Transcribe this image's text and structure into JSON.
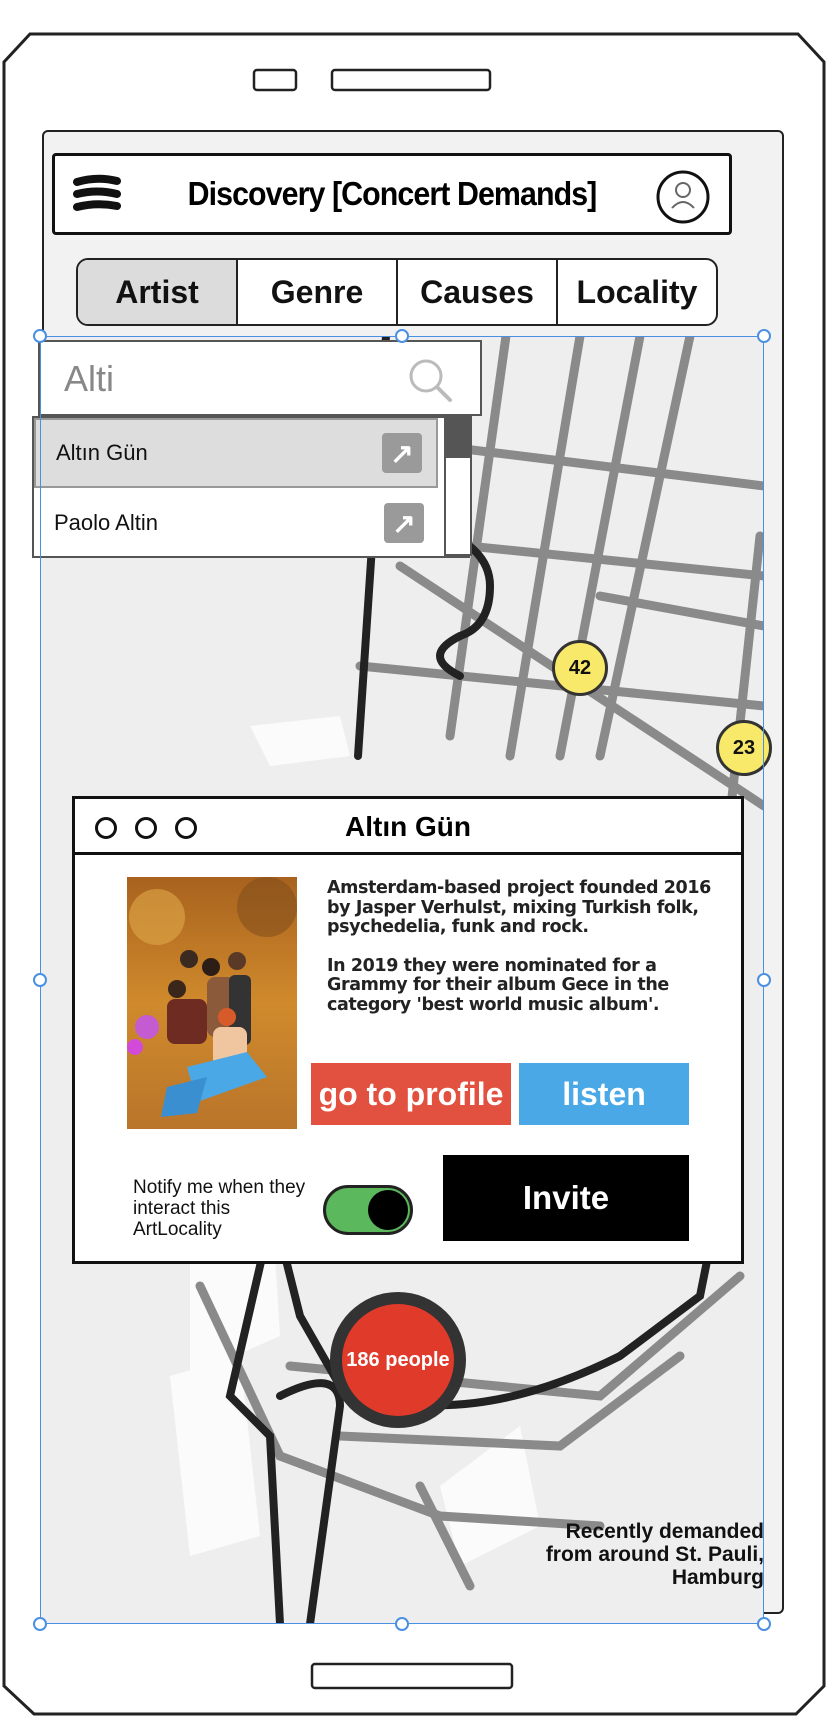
{
  "header": {
    "title": "Discovery [Concert Demands]"
  },
  "tabs": [
    {
      "label": "Artist",
      "selected": true
    },
    {
      "label": "Genre"
    },
    {
      "label": "Causes"
    },
    {
      "label": "Locality"
    }
  ],
  "search": {
    "value": "Alti"
  },
  "dropdown": {
    "items": [
      {
        "label": "Altın Gün",
        "highlighted": true
      },
      {
        "label": "Paolo Altin"
      }
    ]
  },
  "map": {
    "markers": [
      "42",
      "23"
    ],
    "people_count": "186 people",
    "caption_lines": [
      "Recently demanded",
      "from around St. Pauli,",
      "Hamburg"
    ]
  },
  "popup": {
    "title": "Altın Gün",
    "description": [
      "Amsterdam-based project founded 2016 by Jasper Verhulst, mixing Turkish folk, psychedelia, funk and rock.",
      "In 2019 they were nominated for a Grammy for their album Gece in the category 'best world music album'."
    ],
    "profile_label": "go to profile",
    "listen_label": "listen",
    "notify_text": "Notify me when they interact this ArtLocality",
    "notify_enabled": true,
    "invite_label": "Invite"
  },
  "colors": {
    "profile_button": "#e2503f",
    "listen_button": "#4aa8e6",
    "invite_button": "#000000",
    "toggle_on": "#5cb85c",
    "marker": "#f8e96a",
    "people_marker": "#e03a2b",
    "selection": "#4a90e2"
  },
  "icons": {
    "menu": "hamburger-icon",
    "profile": "user-avatar-icon",
    "search": "search-icon",
    "external": "external-link-icon"
  }
}
